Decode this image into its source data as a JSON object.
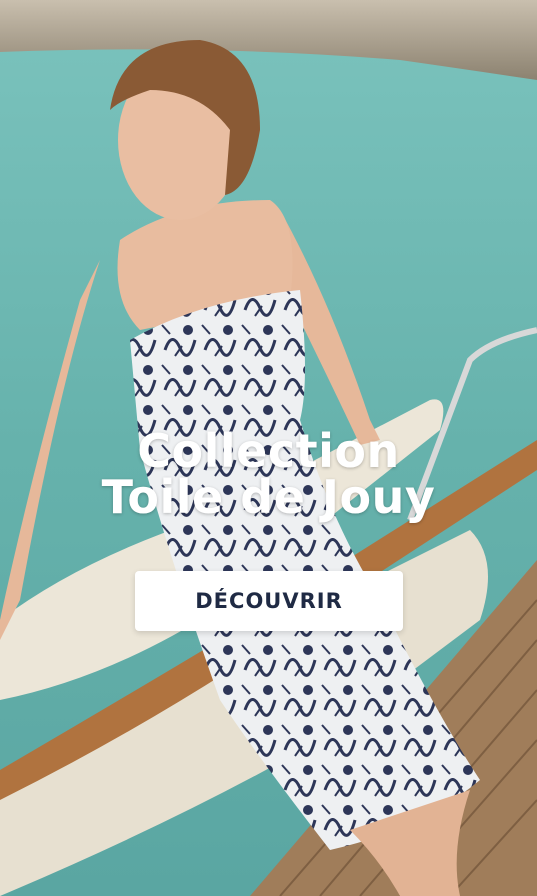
{
  "banner": {
    "title_line1": "Collection",
    "title_line2": "Toile de Jouy",
    "cta_label": "DÉCOUVRIR"
  },
  "colors": {
    "sea": "#6fb9b3",
    "cta_background": "#ffffff",
    "cta_text": "#1f2a44",
    "title_text": "#ffffff"
  }
}
